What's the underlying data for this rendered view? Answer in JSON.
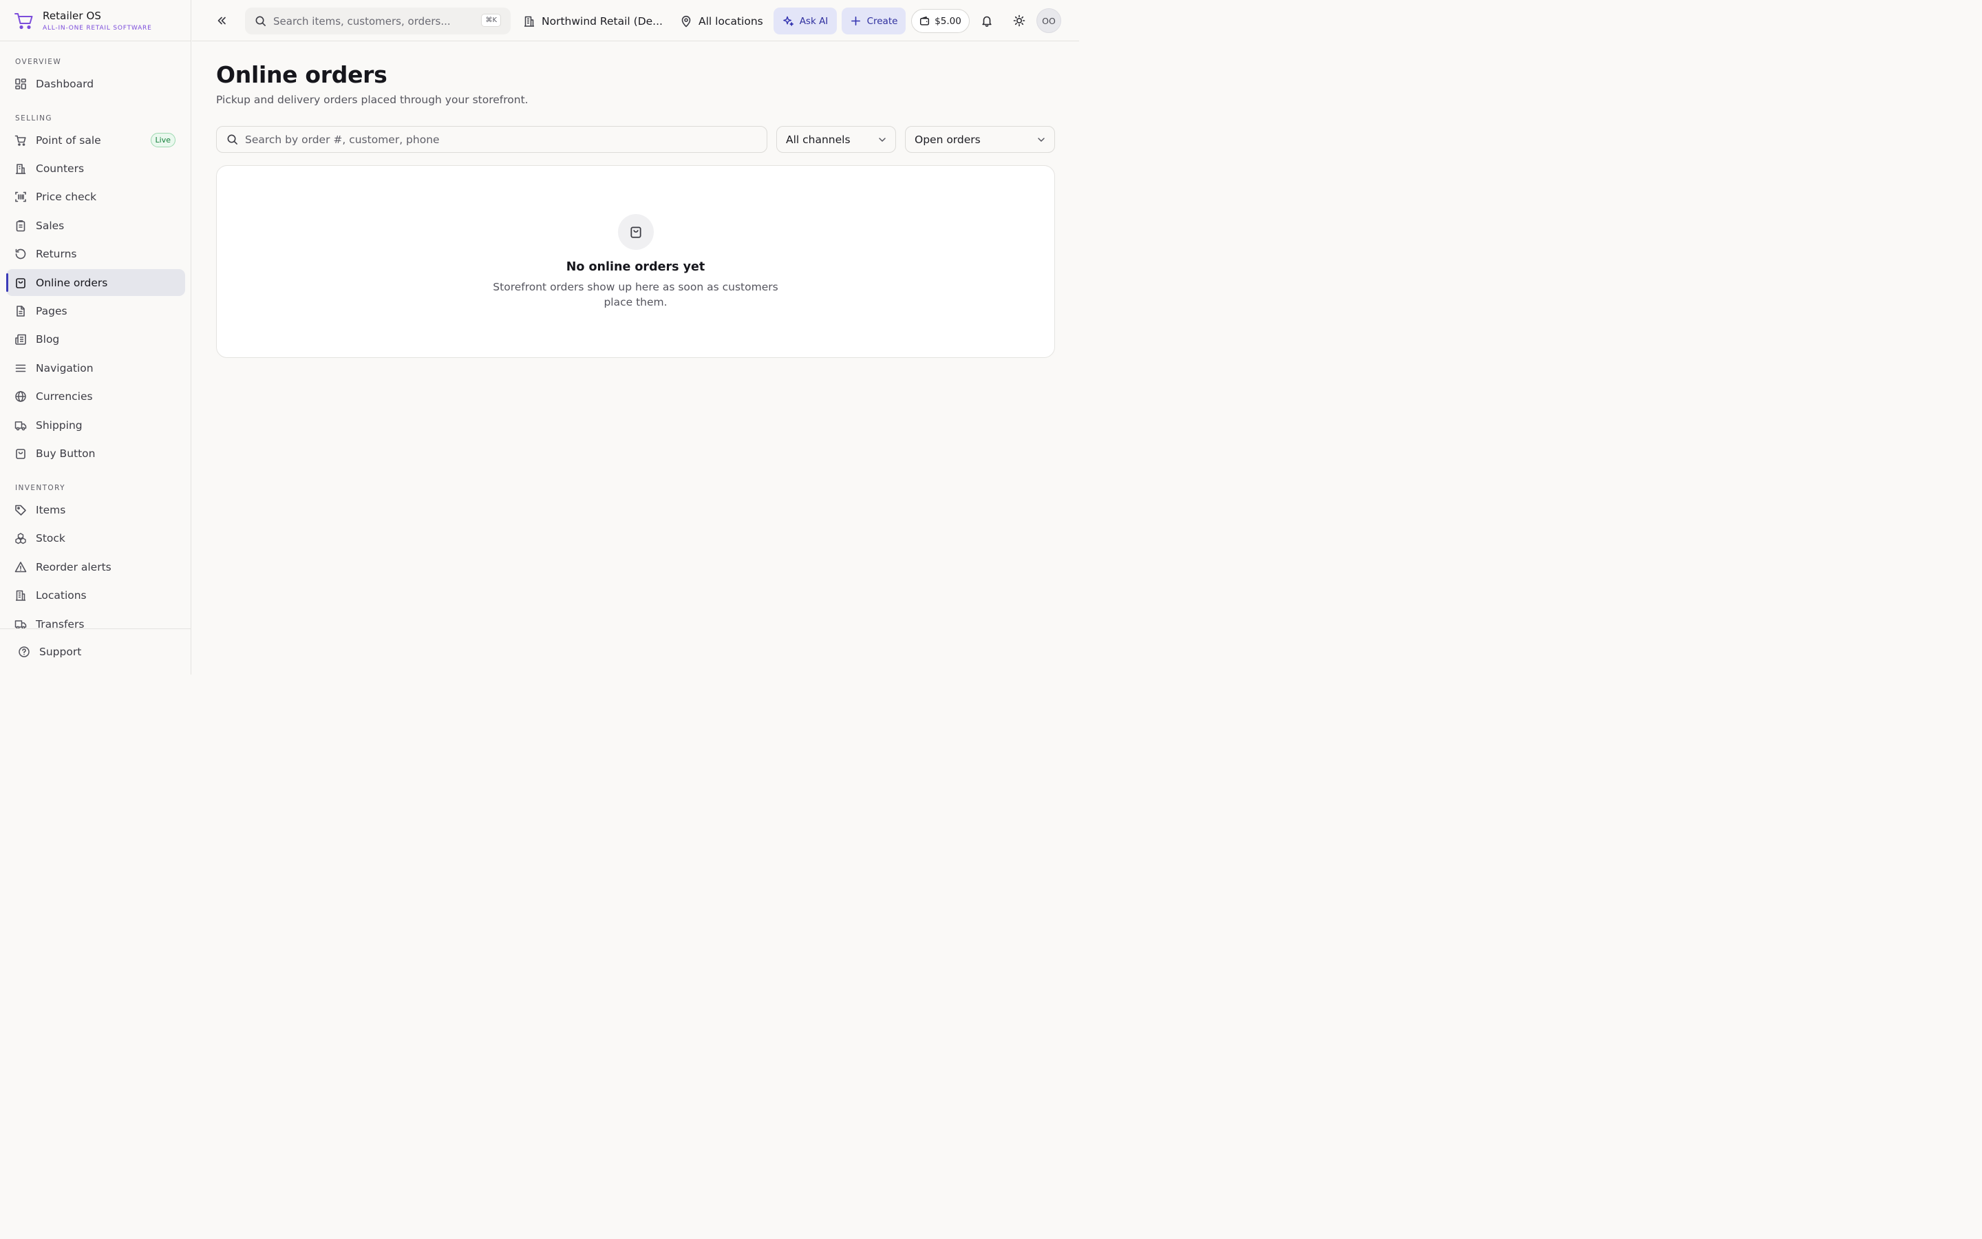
{
  "brand": {
    "name": "Retailer OS",
    "tagline": "ALL-IN-ONE RETAIL SOFTWARE",
    "accent": "#7c4ddb"
  },
  "sidebar": {
    "sections": [
      {
        "title": "OVERVIEW"
      },
      {
        "title": "SELLING"
      },
      {
        "title": "INVENTORY"
      }
    ],
    "items": [
      {
        "label": "Dashboard",
        "icon": "dashboard-grid-icon"
      },
      {
        "label": "Point of sale",
        "icon": "cart-icon",
        "badge": "Live"
      },
      {
        "label": "Counters",
        "icon": "counter-icon"
      },
      {
        "label": "Price check",
        "icon": "barcode-scan-icon"
      },
      {
        "label": "Sales",
        "icon": "clipboard-icon"
      },
      {
        "label": "Returns",
        "icon": "return-arrow-icon"
      },
      {
        "label": "Online orders",
        "icon": "shopping-bag-icon",
        "active": true
      },
      {
        "label": "Pages",
        "icon": "document-icon"
      },
      {
        "label": "Blog",
        "icon": "newspaper-icon"
      },
      {
        "label": "Navigation",
        "icon": "menu-lines-icon"
      },
      {
        "label": "Currencies",
        "icon": "globe-icon"
      },
      {
        "label": "Shipping",
        "icon": "truck-icon"
      },
      {
        "label": "Buy Button",
        "icon": "shopping-bag-icon"
      },
      {
        "label": "Items",
        "icon": "tag-icon"
      },
      {
        "label": "Stock",
        "icon": "boxes-icon"
      },
      {
        "label": "Reorder alerts",
        "icon": "warning-triangle-icon"
      },
      {
        "label": "Locations",
        "icon": "building-icon"
      },
      {
        "label": "Transfers",
        "icon": "truck-icon"
      }
    ],
    "footer": {
      "label": "Support",
      "icon": "help-circle-icon"
    }
  },
  "topbar": {
    "search_placeholder": "Search items, customers, orders...",
    "search_shortcut": "⌘K",
    "org_name": "Northwind Retail (De...",
    "location": "All locations",
    "ask_ai_label": "Ask AI",
    "create_label": "Create",
    "balance": "$5.00",
    "avatar_initials": "OO"
  },
  "main": {
    "title": "Online orders",
    "subtitle": "Pickup and delivery orders placed through your storefront.",
    "search_placeholder": "Search by order #, customer, phone",
    "channel_filter": "All channels",
    "status_filter": "Open orders",
    "empty_state": {
      "title": "No online orders yet",
      "description": "Storefront orders show up here as soon as customers place them."
    }
  },
  "colors": {
    "active_indicator": "#3b3bb8",
    "primary_button_bg": "#e3e5f8",
    "primary_button_text": "#2f2f9e",
    "live_badge": "#16803c"
  }
}
